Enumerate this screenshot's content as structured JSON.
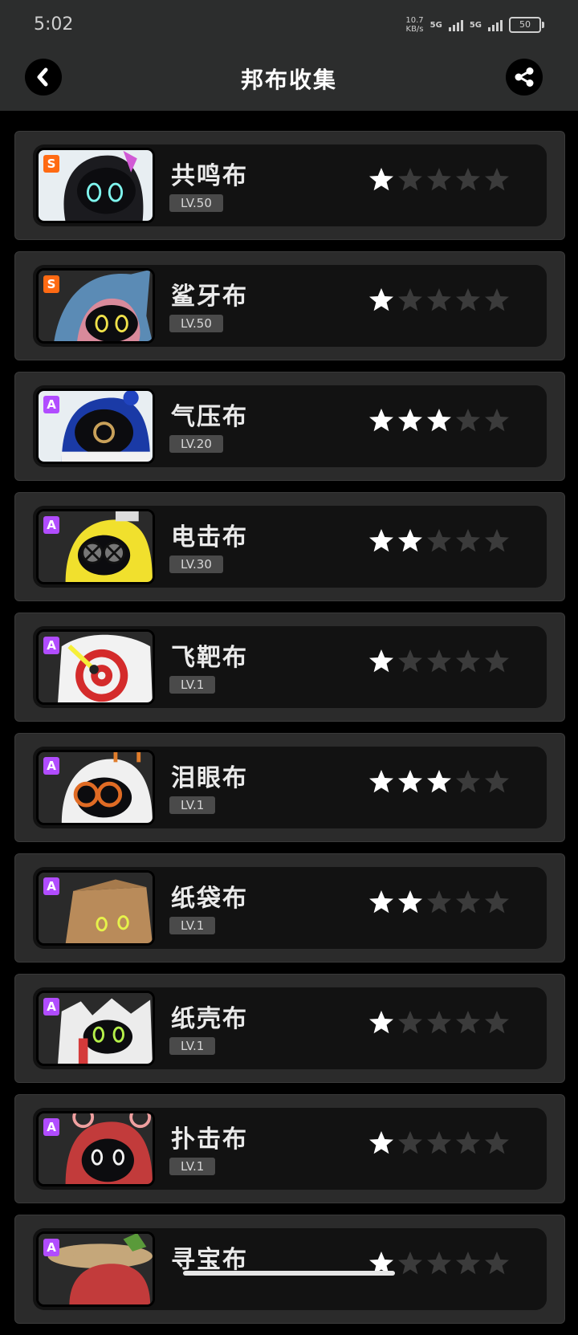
{
  "status_bar": {
    "time": "5:02",
    "speed_value": "10.7",
    "speed_unit": "KB/s",
    "net1": "5G",
    "net2": "5G",
    "battery": "50"
  },
  "header": {
    "title": "邦布收集"
  },
  "icons": {
    "back": "chevron-left-icon",
    "share": "share-icon",
    "star": "star-icon"
  },
  "colors": {
    "rank_s": "#ff6a13",
    "rank_a": "#b14cff",
    "star_on": "#ffffff",
    "star_off": "#3b3b3b"
  },
  "bangboo": [
    {
      "name": "共鸣布",
      "level": "LV.50",
      "rank": "S",
      "stars": 1,
      "max_stars": 5
    },
    {
      "name": "鲨牙布",
      "level": "LV.50",
      "rank": "S",
      "stars": 1,
      "max_stars": 5
    },
    {
      "name": "气压布",
      "level": "LV.20",
      "rank": "A",
      "stars": 3,
      "max_stars": 5
    },
    {
      "name": "电击布",
      "level": "LV.30",
      "rank": "A",
      "stars": 2,
      "max_stars": 5
    },
    {
      "name": "飞靶布",
      "level": "LV.1",
      "rank": "A",
      "stars": 1,
      "max_stars": 5
    },
    {
      "name": "泪眼布",
      "level": "LV.1",
      "rank": "A",
      "stars": 3,
      "max_stars": 5
    },
    {
      "name": "纸袋布",
      "level": "LV.1",
      "rank": "A",
      "stars": 2,
      "max_stars": 5
    },
    {
      "name": "纸壳布",
      "level": "LV.1",
      "rank": "A",
      "stars": 1,
      "max_stars": 5
    },
    {
      "name": "扑击布",
      "level": "LV.1",
      "rank": "A",
      "stars": 1,
      "max_stars": 5
    },
    {
      "name": "寻宝布",
      "level": "",
      "rank": "A",
      "stars": 1,
      "max_stars": 5
    }
  ]
}
